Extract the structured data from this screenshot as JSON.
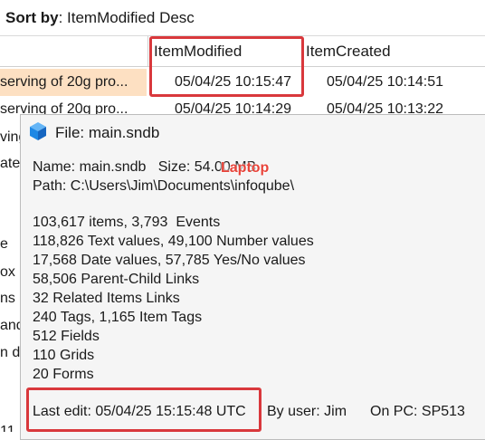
{
  "sort_bar": {
    "label": "Sort by",
    "separator": ":",
    "value": "ItemModified Desc"
  },
  "columns": {
    "modified": "ItemModified",
    "created": "ItemCreated"
  },
  "rows": [
    {
      "title": "serving of 20g pro...",
      "modified": "05/04/25 10:15:47",
      "created": "05/04/25 10:14:51",
      "selected": true
    },
    {
      "title": "serving of 20g pro...",
      "modified": "05/04/25 10:14:29",
      "created": "05/04/25 10:13:22",
      "selected": false
    }
  ],
  "left_fragments": [
    "ving",
    "ate",
    "e",
    "ox",
    "ns",
    "and",
    "n de",
    "11"
  ],
  "file_info": {
    "title": "File: main.sndb",
    "name_line": "Name: main.sndb   Size: 54.00 MB",
    "path_line": "Path: C:\\Users\\Jim\\Documents\\infoqube\\",
    "stats": [
      "103,617 items, 3,793  Events",
      "118,826 Text values, 49,100 Number values",
      "17,568 Date values, 57,785 Yes/No values",
      "58,506 Parent-Child Links",
      "32 Related Items Links",
      "240 Tags, 1,165 Item Tags",
      "512 Fields",
      "110 Grids",
      "20 Forms"
    ],
    "last_edit": "Last edit: 05/04/25 15:15:48 UTC",
    "by_user": "By user: Jim",
    "on_pc": "On PC: SP513"
  },
  "annotation": "Laptop",
  "colors": {
    "selected_row": "#fde0c2",
    "highlight_box": "#d9383c",
    "annotation_text": "#e8443a",
    "cube_icon": "#1e88e5"
  }
}
